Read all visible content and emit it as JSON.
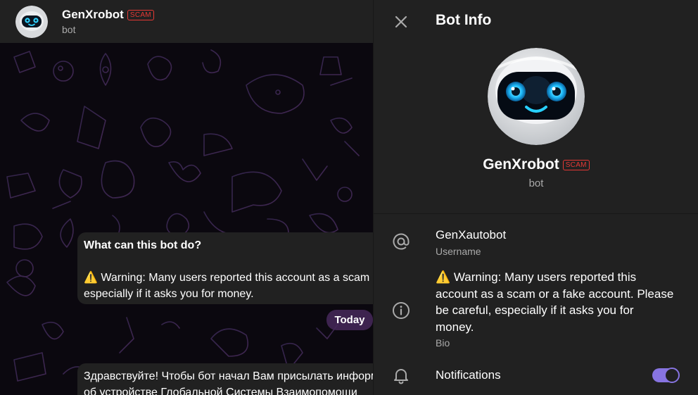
{
  "chat_header": {
    "name": "GenXrobot",
    "badge": "SCAM",
    "subtitle": "bot"
  },
  "chat": {
    "info_bubble": {
      "title": "What can this bot do?",
      "line1": "⚠️ Warning: Many users reported this account as a scam or a fake account. Please be careful,",
      "line2": "especially if it asks you for money."
    },
    "date_pill": "Today",
    "message": {
      "line1": "Здравствуйте! Чтобы бот начал Вам присылать информацию",
      "line2": "об устройстве Глобальной Системы Взаимопомощи"
    }
  },
  "panel": {
    "title": "Bot Info",
    "close_icon": "close-icon",
    "name": "GenXrobot",
    "badge": "SCAM",
    "subtitle": "bot",
    "username": {
      "value": "GenXautobot",
      "caption": "Username",
      "icon": "at-icon"
    },
    "bio": {
      "value": "⚠️ Warning: Many users reported this account as a scam or a fake account. Please be careful, especially if it asks you for money.",
      "caption": "Bio",
      "icon": "info-icon"
    },
    "notifications": {
      "label": "Notifications",
      "enabled": true,
      "icon": "bell-icon"
    }
  },
  "colors": {
    "accent": "#8774e1",
    "scam": "#e53935",
    "panel_bg": "#212121",
    "secondary_text": "#aaaaaa"
  }
}
